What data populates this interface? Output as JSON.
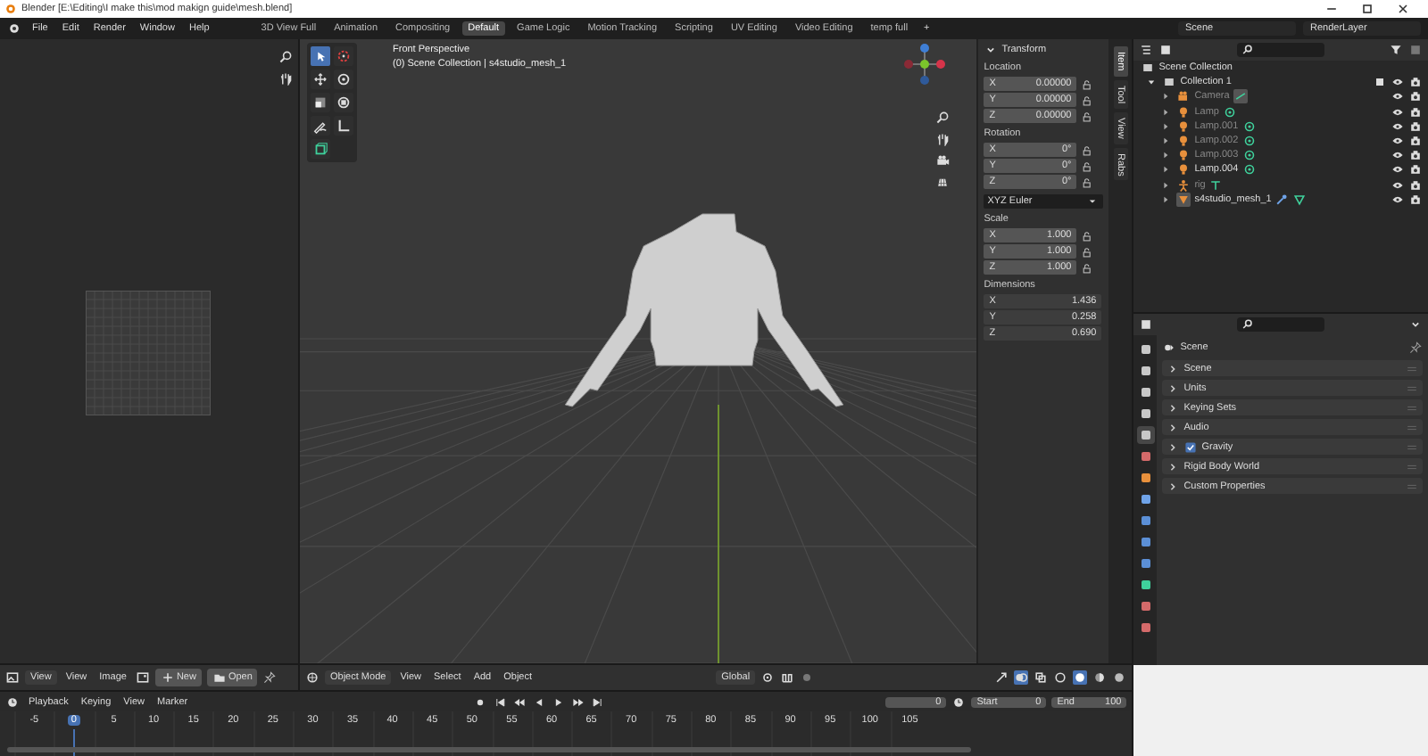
{
  "title_bar": {
    "title": "Blender [E:\\Editing\\I make this\\mod makign guide\\mesh.blend]"
  },
  "top_bar": {
    "menus": [
      "File",
      "Edit",
      "Render",
      "Window",
      "Help"
    ],
    "workspaces": [
      {
        "label": "3D View Full",
        "selected": false
      },
      {
        "label": "Animation",
        "selected": false
      },
      {
        "label": "Compositing",
        "selected": false
      },
      {
        "label": "Default",
        "selected": true
      },
      {
        "label": "Game Logic",
        "selected": false
      },
      {
        "label": "Motion Tracking",
        "selected": false
      },
      {
        "label": "Scripting",
        "selected": false
      },
      {
        "label": "UV Editing",
        "selected": false
      },
      {
        "label": "Video Editing",
        "selected": false
      },
      {
        "label": "temp full",
        "selected": false
      }
    ],
    "add_workspace": "+",
    "scene": "Scene",
    "view_layer": "RenderLayer"
  },
  "image_editor": {
    "header": {
      "mode": "View",
      "menus": [
        "View",
        "Image"
      ],
      "new": "New",
      "open": "Open"
    }
  },
  "viewport": {
    "view_name": "Front Perspective",
    "collection_info": "(0) Scene Collection | s4studio_mesh_1",
    "tools": [
      {
        "kind": "select",
        "selected": true
      },
      {
        "kind": "cursor",
        "selected": false
      },
      {
        "kind": "move",
        "selected": false
      },
      {
        "kind": "rotate",
        "selected": false
      },
      {
        "kind": "scale",
        "selected": false
      },
      {
        "kind": "transform",
        "selected": false
      },
      {
        "kind": "annotate",
        "selected": false
      },
      {
        "kind": "measure",
        "selected": false
      },
      {
        "kind": "add-cube",
        "selected": false
      }
    ],
    "header": {
      "mode": "Object Mode",
      "menus": [
        "View",
        "Select",
        "Add",
        "Object"
      ],
      "orientation": "Global"
    }
  },
  "sidebar": {
    "title": "Transform",
    "tabs": [
      {
        "label": "Item",
        "selected": true
      },
      {
        "label": "Tool",
        "selected": false
      },
      {
        "label": "View",
        "selected": false
      },
      {
        "label": "Rabs",
        "selected": false
      }
    ],
    "groups": [
      {
        "label": "Location",
        "locks": true,
        "fields": [
          {
            "axis": "X",
            "value": "0.00000"
          },
          {
            "axis": "Y",
            "value": "0.00000"
          },
          {
            "axis": "Z",
            "value": "0.00000"
          }
        ]
      },
      {
        "label": "Rotation",
        "locks": true,
        "fields": [
          {
            "axis": "X",
            "value": "0°"
          },
          {
            "axis": "Y",
            "value": "0°"
          },
          {
            "axis": "Z",
            "value": "0°"
          }
        ],
        "mode": "XYZ Euler"
      },
      {
        "label": "Scale",
        "locks": true,
        "fields": [
          {
            "axis": "X",
            "value": "1.000"
          },
          {
            "axis": "Y",
            "value": "1.000"
          },
          {
            "axis": "Z",
            "value": "1.000"
          }
        ]
      },
      {
        "label": "Dimensions",
        "locks": false,
        "fields": [
          {
            "axis": "X",
            "value": "1.436"
          },
          {
            "axis": "Y",
            "value": "0.258"
          },
          {
            "axis": "Z",
            "value": "0.690"
          }
        ]
      }
    ]
  },
  "outliner": {
    "root": "Scene Collection",
    "collection": "Collection 1",
    "items": [
      {
        "name": "Camera",
        "kind": "camera",
        "disabled": true
      },
      {
        "name": "Lamp",
        "kind": "lamp",
        "disabled": true
      },
      {
        "name": "Lamp.001",
        "kind": "lamp",
        "disabled": true
      },
      {
        "name": "Lamp.002",
        "kind": "lamp",
        "disabled": true
      },
      {
        "name": "Lamp.003",
        "kind": "lamp",
        "disabled": true
      },
      {
        "name": "Lamp.004",
        "kind": "lamp",
        "disabled": false
      },
      {
        "name": "rig",
        "kind": "armature",
        "disabled": true
      },
      {
        "name": "s4studio_mesh_1",
        "kind": "mesh",
        "disabled": false
      }
    ]
  },
  "properties": {
    "title": "Scene",
    "tabs": [
      {
        "color": "#c8c8c8",
        "selected": false
      },
      {
        "color": "#c8c8c8",
        "selected": false
      },
      {
        "color": "#c8c8c8",
        "selected": false
      },
      {
        "color": "#c8c8c8",
        "selected": false
      },
      {
        "color": "#c8c8c8",
        "selected": true
      },
      {
        "color": "#d46a6a",
        "selected": false
      },
      {
        "color": "#e8903c",
        "selected": false
      },
      {
        "color": "#6fa3e8",
        "selected": false
      },
      {
        "color": "#5b8fd6",
        "selected": false
      },
      {
        "color": "#5b8fd6",
        "selected": false
      },
      {
        "color": "#5b8fd6",
        "selected": false
      },
      {
        "color": "#3fd19c",
        "selected": false
      },
      {
        "color": "#d46a6a",
        "selected": false
      },
      {
        "color": "#d46a6a",
        "selected": false
      }
    ],
    "panels": [
      {
        "label": "Scene",
        "kind": "panel"
      },
      {
        "label": "Units",
        "kind": "panel"
      },
      {
        "label": "Keying Sets",
        "kind": "panel"
      },
      {
        "label": "Audio",
        "kind": "panel"
      },
      {
        "label": "Gravity",
        "kind": "checkbox",
        "checked": true
      },
      {
        "label": "Rigid Body World",
        "kind": "panel"
      },
      {
        "label": "Custom Properties",
        "kind": "panel"
      }
    ]
  },
  "timeline": {
    "menus": [
      "Playback",
      "Keying",
      "View",
      "Marker"
    ],
    "current_frame": "0",
    "start_label": "Start",
    "start": "0",
    "end_label": "End",
    "end": "100",
    "ruler": [
      {
        "label": "-5",
        "selected": false
      },
      {
        "label": "0",
        "selected": true
      },
      {
        "label": "5",
        "selected": false
      },
      {
        "label": "10",
        "selected": false
      },
      {
        "label": "15",
        "selected": false
      },
      {
        "label": "20",
        "selected": false
      },
      {
        "label": "25",
        "selected": false
      },
      {
        "label": "30",
        "selected": false
      },
      {
        "label": "35",
        "selected": false
      },
      {
        "label": "40",
        "selected": false
      },
      {
        "label": "45",
        "selected": false
      },
      {
        "label": "50",
        "selected": false
      },
      {
        "label": "55",
        "selected": false
      },
      {
        "label": "60",
        "selected": false
      },
      {
        "label": "65",
        "selected": false
      },
      {
        "label": "70",
        "selected": false
      },
      {
        "label": "75",
        "selected": false
      },
      {
        "label": "80",
        "selected": false
      },
      {
        "label": "85",
        "selected": false
      },
      {
        "label": "90",
        "selected": false
      },
      {
        "label": "95",
        "selected": false
      },
      {
        "label": "100",
        "selected": false
      },
      {
        "label": "105",
        "selected": false
      }
    ]
  }
}
